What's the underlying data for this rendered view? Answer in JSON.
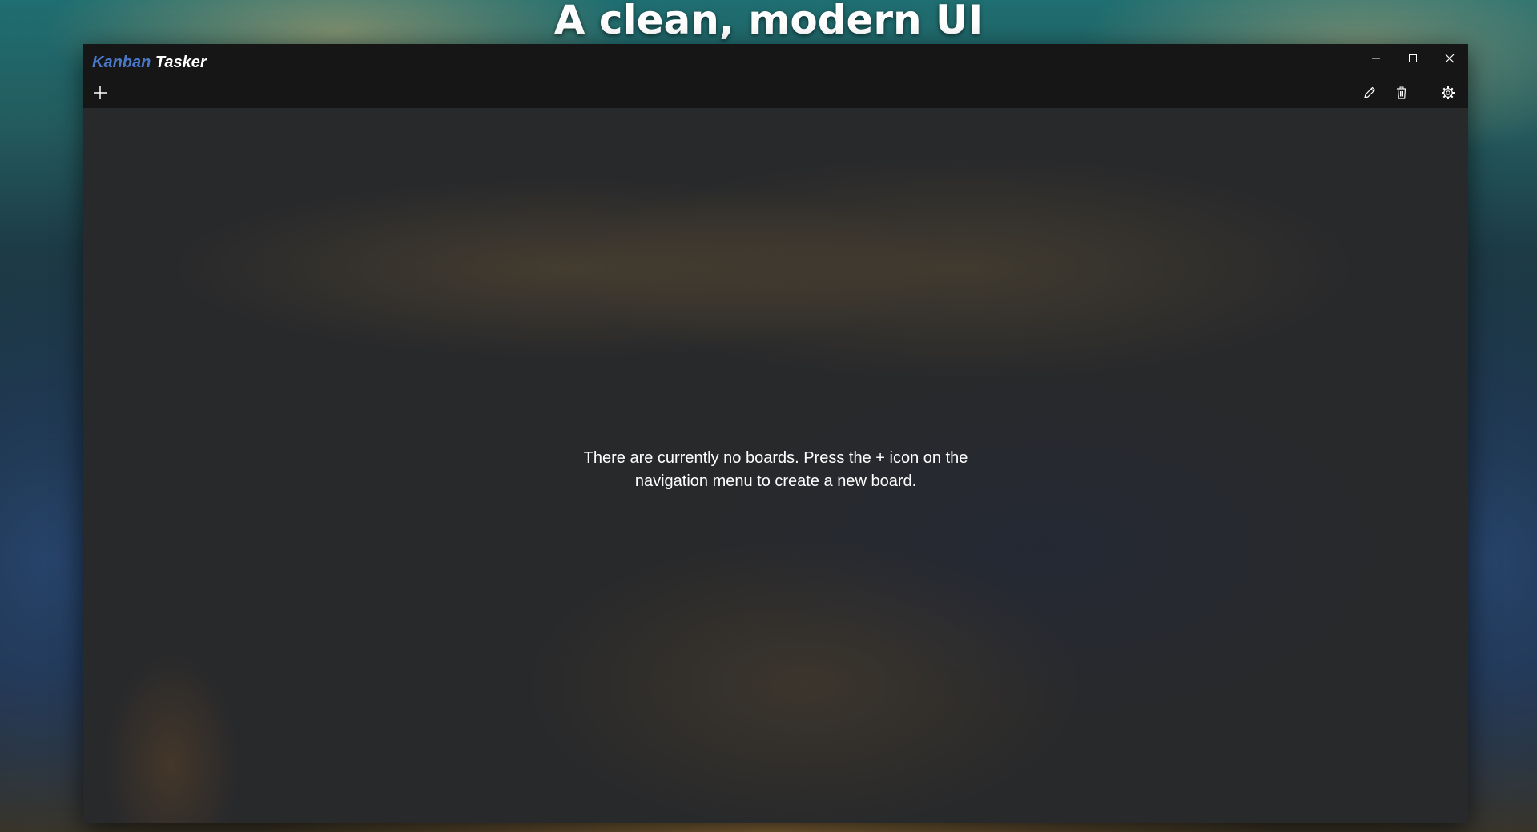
{
  "caption": "A clean, modern UI",
  "app": {
    "title_part1": "Kanban",
    "title_part2": "Tasker"
  },
  "window_controls": [
    "minimize",
    "maximize",
    "close"
  ],
  "toolbar": {
    "left": [
      {
        "icon": "plus-icon"
      }
    ],
    "right": [
      {
        "icon": "pencil-icon"
      },
      {
        "icon": "trash-icon"
      },
      {
        "icon": "gear-icon"
      }
    ]
  },
  "main": {
    "empty_message": "There are currently no boards. Press the + icon on the\nnavigation menu to create a new board."
  },
  "colors": {
    "titlebar": "#161617",
    "content": "#28292b",
    "title_accent": "#4a78c8",
    "text": "#ffffff"
  }
}
